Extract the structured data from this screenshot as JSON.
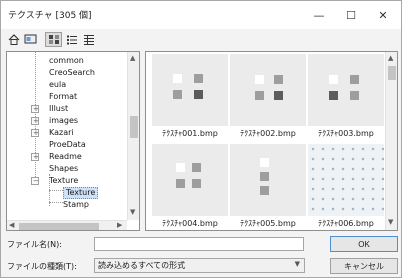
{
  "window": {
    "title": "テクスチャ [305 個]",
    "minimize": "—",
    "maximize": "☐",
    "close": "✕"
  },
  "toolbar": {
    "icons": [
      "home-icon",
      "desktop-icon",
      "thumbnail-view-icon",
      "list-view-icon",
      "details-view-icon"
    ],
    "active": "thumbnail-view-icon"
  },
  "tree": {
    "items": [
      {
        "label": "common",
        "expandable": false
      },
      {
        "label": "CreoSearch",
        "expandable": false
      },
      {
        "label": "eula",
        "expandable": false
      },
      {
        "label": "Format",
        "expandable": false
      },
      {
        "label": "Illust",
        "expandable": true,
        "state": "+"
      },
      {
        "label": "images",
        "expandable": true,
        "state": "+"
      },
      {
        "label": "Kazari",
        "expandable": true,
        "state": "+"
      },
      {
        "label": "ProeData",
        "expandable": false
      },
      {
        "label": "Readme",
        "expandable": true,
        "state": "+"
      },
      {
        "label": "Shapes",
        "expandable": false
      },
      {
        "label": "Texture",
        "expandable": true,
        "state": "−"
      },
      {
        "label": "Texture",
        "child": true,
        "selected": true
      },
      {
        "label": "Stamp",
        "child": true
      }
    ]
  },
  "thumbnails": [
    {
      "caption": "ﾃｸｽﾁｬ001.bmp",
      "pattern": "A"
    },
    {
      "caption": "ﾃｸｽﾁｬ002.bmp",
      "pattern": "B"
    },
    {
      "caption": "ﾃｸｽﾁｬ003.bmp",
      "pattern": "C"
    },
    {
      "caption": "ﾃｸｽﾁｬ004.bmp",
      "pattern": "D"
    },
    {
      "caption": "ﾃｸｽﾁｬ005.bmp",
      "pattern": "E"
    },
    {
      "caption": "ﾃｸｽﾁｬ006.bmp",
      "pattern": "dots"
    }
  ],
  "form": {
    "filename_label": "ファイル名(N):",
    "filename_value": "",
    "filetype_label": "ファイルの種類(T):",
    "filetype_value": "読み込めるすべての形式",
    "ok_label": "OK",
    "cancel_label": "キャンセル"
  },
  "colors": {
    "selection": "#cde2f7",
    "ok_border": "#4f8ed0"
  }
}
